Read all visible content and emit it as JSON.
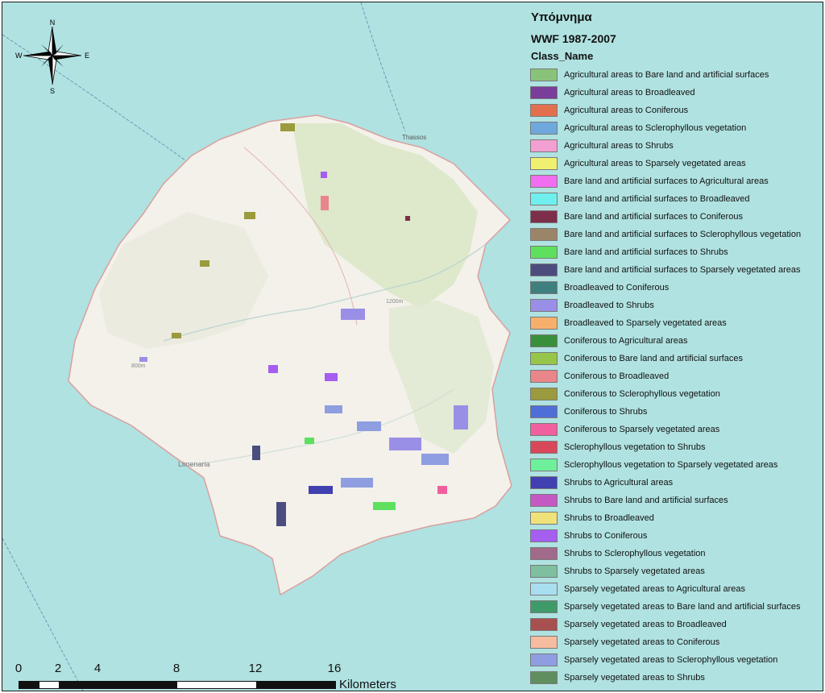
{
  "map": {
    "place_labels": [
      "Thassos",
      "Limenaria",
      "1200m",
      "800m"
    ],
    "water_color": "#b0e2e1",
    "land_color": "#f3f1ea",
    "boundary_color": "#d9a0a0"
  },
  "compass": {
    "icon": "compass-rose-icon",
    "n": "N",
    "s": "S",
    "e": "E",
    "w": "W"
  },
  "legend": {
    "title": "Υπόμνημα",
    "subtitle": "WWF 1987-2007",
    "field": "Class_Name",
    "items": [
      {
        "label": "Agricultural areas to Bare land and artificial surfaces",
        "color": "#89c37a"
      },
      {
        "label": "Agricultural areas to Broadleaved",
        "color": "#7a3d9a"
      },
      {
        "label": "Agricultural areas to Coniferous",
        "color": "#e2704f"
      },
      {
        "label": "Agricultural areas to Sclerophyllous vegetation",
        "color": "#6fa8dc"
      },
      {
        "label": "Agricultural areas to Shrubs",
        "color": "#f29fd1"
      },
      {
        "label": "Agricultural areas to Sparsely vegetated areas",
        "color": "#f0f070"
      },
      {
        "label": "Bare land and artificial surfaces to Agricultural areas",
        "color": "#f06ef0"
      },
      {
        "label": "Bare land and artificial surfaces to Broadleaved",
        "color": "#6ff0ee"
      },
      {
        "label": "Bare land and artificial surfaces to Coniferous",
        "color": "#7d2f4a"
      },
      {
        "label": "Bare land and artificial surfaces to Sclerophyllous vegetation",
        "color": "#9b8569"
      },
      {
        "label": "Bare land and artificial surfaces to Shrubs",
        "color": "#5ee05e"
      },
      {
        "label": "Bare land and artificial surfaces to Sparsely vegetated areas",
        "color": "#4b4d7e"
      },
      {
        "label": "Broadleaved to Coniferous",
        "color": "#3f7f7f"
      },
      {
        "label": "Broadleaved to Shrubs",
        "color": "#9a8fe6"
      },
      {
        "label": "Broadleaved to Sparsely vegetated areas",
        "color": "#f6b06c"
      },
      {
        "label": "Coniferous to Agricultural areas",
        "color": "#3a8f3a"
      },
      {
        "label": "Coniferous to Bare land and artificial surfaces",
        "color": "#95c64a"
      },
      {
        "label": "Coniferous to Broadleaved",
        "color": "#e8868a"
      },
      {
        "label": "Coniferous to Sclerophyllous vegetation",
        "color": "#9a9a3e"
      },
      {
        "label": "Coniferous to Shrubs",
        "color": "#4f6fd8"
      },
      {
        "label": "Coniferous to Sparsely vegetated areas",
        "color": "#f05f9e"
      },
      {
        "label": "Sclerophyllous vegetation to Shrubs",
        "color": "#d8485a"
      },
      {
        "label": "Sclerophyllous vegetation to Sparsely vegetated areas",
        "color": "#6ef09a"
      },
      {
        "label": "Shrubs to Agricultural areas",
        "color": "#4040b0"
      },
      {
        "label": "Shrubs to Bare land and artificial surfaces",
        "color": "#c459c4"
      },
      {
        "label": "Shrubs to Broadleaved",
        "color": "#f0e27a"
      },
      {
        "label": "Shrubs to Coniferous",
        "color": "#a55ef0"
      },
      {
        "label": "Shrubs to Sclerophyllous vegetation",
        "color": "#a06a8a"
      },
      {
        "label": "Shrubs to Sparsely vegetated areas",
        "color": "#7dbf9e"
      },
      {
        "label": "Sparsely vegetated areas to Agricultural areas",
        "color": "#a8def0"
      },
      {
        "label": "Sparsely vegetated areas to Bare land and artificial surfaces",
        "color": "#3f9a6a"
      },
      {
        "label": "Sparsely vegetated areas to Broadleaved",
        "color": "#a85050"
      },
      {
        "label": "Sparsely vegetated areas to Coniferous",
        "color": "#f6bca0"
      },
      {
        "label": "Sparsely vegetated areas to Sclerophyllous vegetation",
        "color": "#8f9ee0"
      },
      {
        "label": "Sparsely vegetated areas to Shrubs",
        "color": "#5f8f5f"
      }
    ]
  },
  "scalebar": {
    "ticks": [
      "0",
      "2",
      "4",
      "8",
      "12",
      "16"
    ],
    "unit": "Kilometers"
  }
}
